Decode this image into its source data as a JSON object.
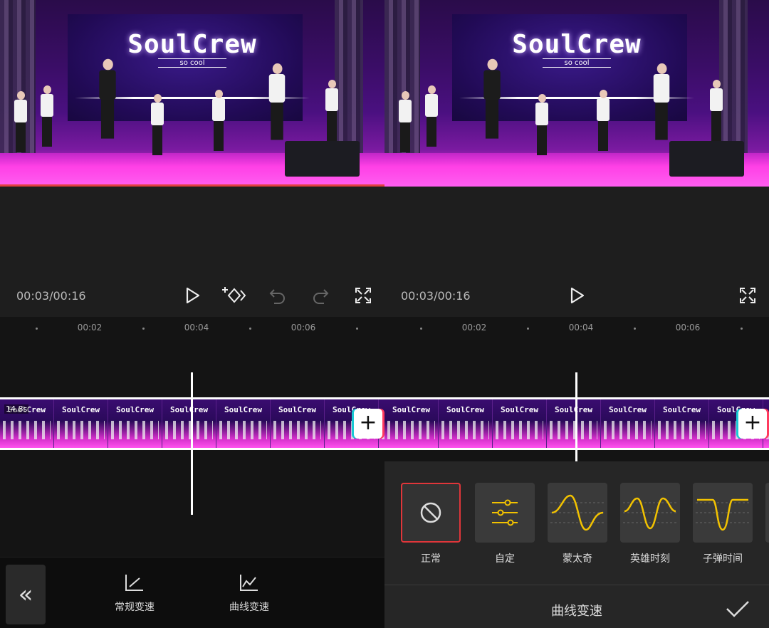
{
  "left": {
    "video": {
      "logo": "SoulCrew",
      "logo_sub": "so cool"
    },
    "timecode": "00:03/00:16",
    "ruler": [
      "00:02",
      "00:04",
      "00:06"
    ],
    "clip": {
      "frame_logo": "SoulCrew",
      "duration": "14.8s"
    },
    "add_label": "+",
    "back_label": "«",
    "tools": [
      {
        "label": "常规变速",
        "icon": "speed-normal-icon"
      },
      {
        "label": "曲线变速",
        "icon": "speed-curve-icon"
      }
    ]
  },
  "right": {
    "video": {
      "logo": "SoulCrew",
      "logo_sub": "so cool"
    },
    "timecode": "00:03/00:16",
    "ruler": [
      "00:02",
      "00:04",
      "00:06"
    ],
    "clip": {
      "frame_logo": "SoulCrew"
    },
    "add_label": "+",
    "presets": [
      {
        "label": "正常",
        "icon": "none-icon",
        "selected": true
      },
      {
        "label": "自定",
        "icon": "sliders-icon"
      },
      {
        "label": "蒙太奇",
        "icon": "montage-curve-icon"
      },
      {
        "label": "英雄时刻",
        "icon": "hero-curve-icon"
      },
      {
        "label": "子弹时间",
        "icon": "bullet-curve-icon"
      }
    ],
    "sheet_title": "曲线变速"
  },
  "colors": {
    "accent_selected": "#e0363a",
    "curve": "#f2c200",
    "background": "#1e1e1e"
  }
}
